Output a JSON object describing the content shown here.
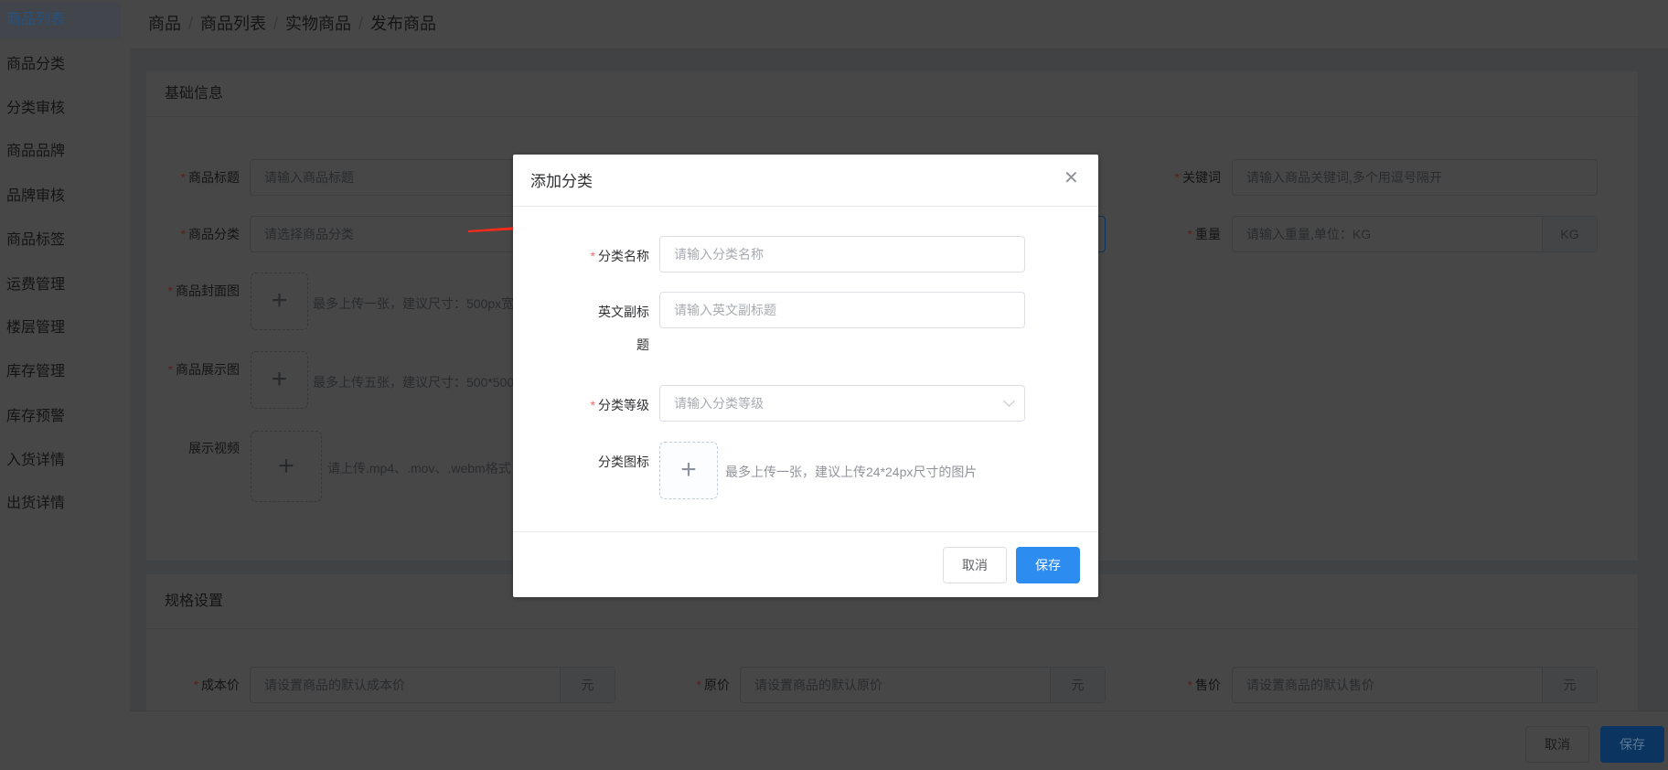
{
  "sidebar": {
    "items": [
      {
        "label": "商品列表",
        "active": true
      },
      {
        "label": "商品分类"
      },
      {
        "label": "分类审核"
      },
      {
        "label": "商品品牌"
      },
      {
        "label": "品牌审核"
      },
      {
        "label": "商品标签"
      },
      {
        "label": "运费管理"
      },
      {
        "label": "楼层管理"
      },
      {
        "label": "库存管理"
      },
      {
        "label": "库存预警"
      },
      {
        "label": "入货详情"
      },
      {
        "label": "出货详情"
      }
    ]
  },
  "breadcrumb": [
    "商品",
    "商品列表",
    "实物商品",
    "发布商品"
  ],
  "basic": {
    "title": "基础信息",
    "product_title": {
      "label": "商品标题",
      "placeholder": "请输入商品标题"
    },
    "keywords": {
      "label": "关键词",
      "placeholder": "请输入商品关键词,多个用逗号隔开"
    },
    "category": {
      "label": "商品分类",
      "placeholder": "请选择商品分类"
    },
    "weight": {
      "label": "重量",
      "placeholder": "请输入重量,单位：KG",
      "suffix": "KG"
    },
    "cover": {
      "label": "商品封面图",
      "hint": "最多上传一张，建议尺寸：500px宽"
    },
    "gallery": {
      "label": "商品展示图",
      "hint": "最多上传五张，建议尺寸：500*500"
    },
    "video": {
      "label": "展示视频",
      "hint": "请上传.mp4、.mov、.webm格式"
    }
  },
  "spec": {
    "title": "规格设置",
    "cost": {
      "label": "成本价",
      "placeholder": "请设置商品的默认成本价",
      "suffix": "元"
    },
    "original": {
      "label": "原价",
      "placeholder": "请设置商品的默认原价",
      "suffix": "元"
    },
    "sale": {
      "label": "售价",
      "placeholder": "请设置商品的默认售价",
      "suffix": "元"
    }
  },
  "page_footer": {
    "cancel": "取消",
    "save": "保存"
  },
  "modal": {
    "title": "添加分类",
    "name": {
      "label": "分类名称",
      "placeholder": "请输入分类名称"
    },
    "subtitle": {
      "label": "英文副标题",
      "placeholder": "请输入英文副标题"
    },
    "level": {
      "label": "分类等级",
      "placeholder": "请输入分类等级"
    },
    "icon": {
      "label": "分类图标",
      "hint": "最多上传一张，建议上传24*24px尺寸的图片"
    },
    "cancel": "取消",
    "save": "保存"
  },
  "colors": {
    "primary": "#1890ff",
    "required": "#f56c6c",
    "annotation_arrow": "#ff2a1a"
  }
}
